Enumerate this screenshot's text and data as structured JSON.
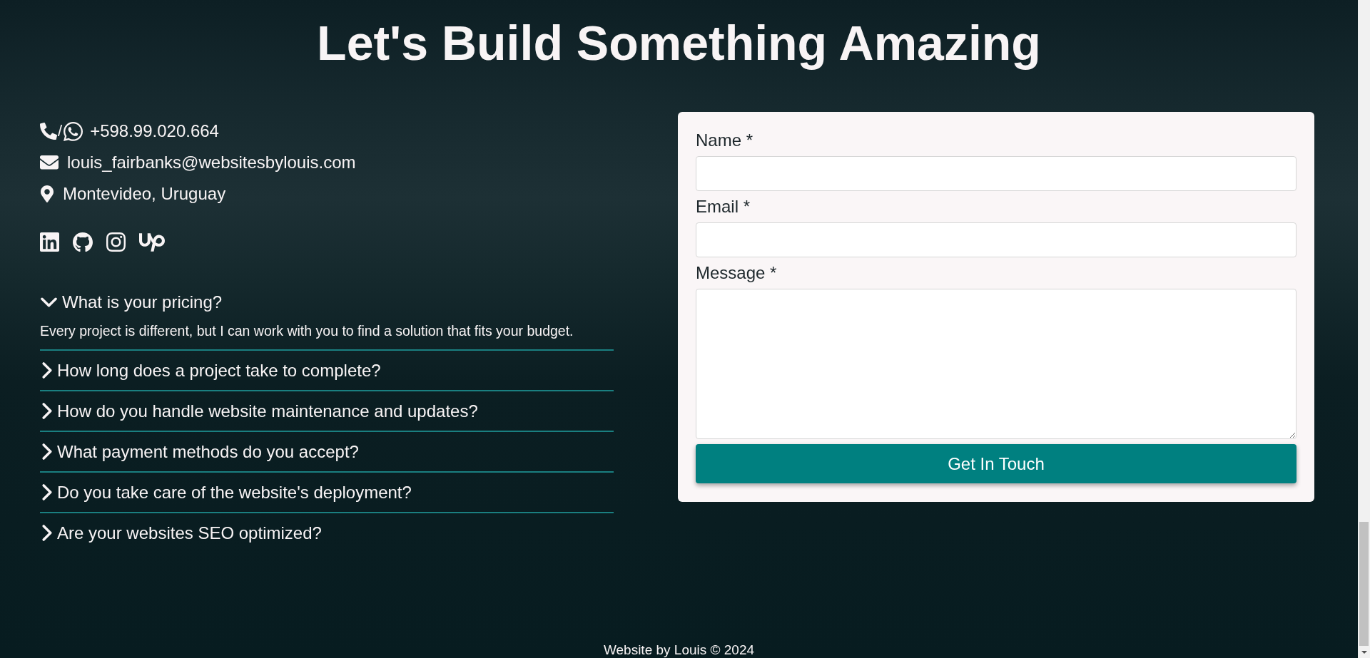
{
  "heading": "Let's Build Something Amazing",
  "contact": {
    "phone_separator": "/",
    "phone": "+598.99.020.664",
    "email": "louis_fairbanks@websitesbylouis.com",
    "location": "Montevideo, Uruguay"
  },
  "faq": [
    {
      "question": "What is your pricing?",
      "expanded": true,
      "answer": "Every project is different, but I can work with you to find a solution that fits your budget."
    },
    {
      "question": "How long does a project take to complete?",
      "expanded": false
    },
    {
      "question": "How do you handle website maintenance and updates?",
      "expanded": false
    },
    {
      "question": "What payment methods do you accept?",
      "expanded": false
    },
    {
      "question": "Do you take care of the website's deployment?",
      "expanded": false
    },
    {
      "question": "Are your websites SEO optimized?",
      "expanded": false
    }
  ],
  "form": {
    "fields": [
      {
        "label": "Name *",
        "kind": "input"
      },
      {
        "label": "Email *",
        "kind": "input"
      },
      {
        "label": "Message *",
        "kind": "textarea"
      }
    ],
    "submit": "Get In Touch"
  },
  "footer": "Website by Louis © 2024"
}
